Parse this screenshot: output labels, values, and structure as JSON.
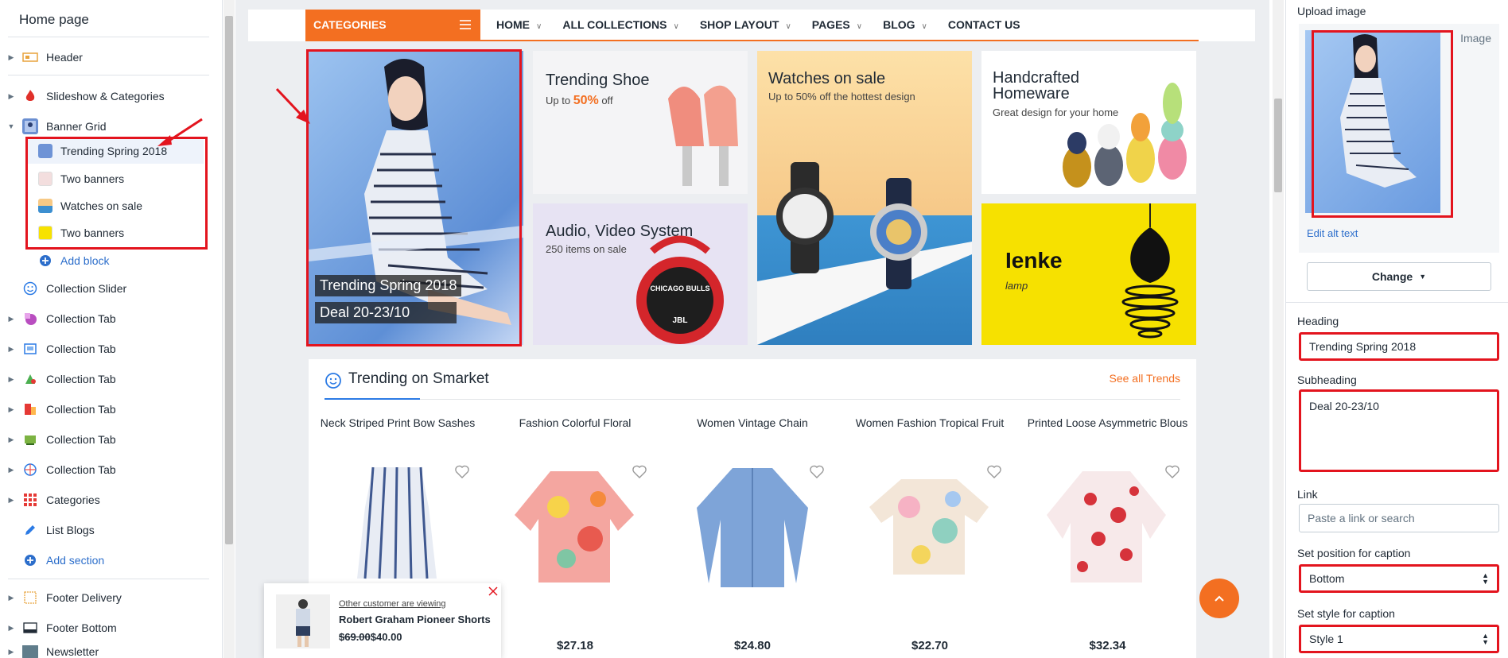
{
  "sidebar": {
    "title": "Home page",
    "sections": [
      {
        "label": "Header",
        "icon": "header-icon"
      },
      {
        "label": "Slideshow & Categories",
        "icon": "slideshow-icon"
      },
      {
        "label": "Banner Grid",
        "icon": "banner-grid-icon",
        "expanded": true
      }
    ],
    "blocks": [
      {
        "label": "Trending Spring 2018",
        "selected": true
      },
      {
        "label": "Two banners"
      },
      {
        "label": "Watches on sale"
      },
      {
        "label": "Two banners"
      }
    ],
    "add_block": "Add block",
    "more_sections": [
      {
        "label": "Collection Slider"
      },
      {
        "label": "Collection Tab"
      },
      {
        "label": "Collection Tab"
      },
      {
        "label": "Collection Tab"
      },
      {
        "label": "Collection Tab"
      },
      {
        "label": "Collection Tab"
      },
      {
        "label": "Collection Tab"
      },
      {
        "label": "Categories"
      },
      {
        "label": "List Blogs"
      }
    ],
    "add_section": "Add section",
    "footer_sections": [
      {
        "label": "Footer Delivery"
      },
      {
        "label": "Footer Bottom"
      },
      {
        "label": "Newsletter"
      }
    ]
  },
  "store": {
    "categories_label": "CATEGORIES",
    "nav": [
      "HOME",
      "ALL COLLECTIONS",
      "SHOP LAYOUT",
      "PAGES",
      "BLOG",
      "CONTACT US"
    ],
    "banners": {
      "main": {
        "heading": "Trending Spring 2018",
        "subheading": "Deal 20-23/10"
      },
      "shoe": {
        "heading": "Trending Shoe",
        "sub_pre": "Up to ",
        "sub_accent": "50%",
        "sub_post": " off"
      },
      "watches": {
        "heading": "Watches on sale",
        "sub": "Up to 50% off the hottest design"
      },
      "homeware": {
        "heading": "Handcrafted Homeware",
        "sub": "Great design for your home"
      },
      "audio": {
        "heading": "Audio, Video System",
        "sub": "250 items on sale",
        "speaker_text": "CHICAGO BULLS",
        "speaker_brand": "JBL"
      },
      "lamp": {
        "heading": "Ienke",
        "sub": "lamp"
      }
    },
    "trending": {
      "title": "Trending on Smarket",
      "see_all": "See all Trends"
    },
    "products": [
      {
        "name": "Neck Striped Print Bow Sashes",
        "price": ""
      },
      {
        "name": "Fashion Colorful Floral",
        "price": "$27.18"
      },
      {
        "name": "Women Vintage Chain",
        "price": "$24.80"
      },
      {
        "name": "Women Fashion Tropical Fruit",
        "price": "$22.70"
      },
      {
        "name": "Printed Loose Asymmetric Blous",
        "price": "$32.34"
      }
    ],
    "popup": {
      "note": "Other customer are viewing",
      "product": "Robert Graham Pioneer Shorts",
      "old_price": "$69.00",
      "new_price": "$40.00"
    }
  },
  "panel": {
    "upload_label": "Upload image",
    "image_tag": "Image",
    "edit_alt": "Edit alt text",
    "change_button": "Change",
    "heading_label": "Heading",
    "heading_value": "Trending Spring 2018",
    "subheading_label": "Subheading",
    "subheading_value": "Deal 20-23/10",
    "link_label": "Link",
    "link_placeholder": "Paste a link or search",
    "position_label": "Set position for caption",
    "position_value": "Bottom",
    "style_label": "Set style for caption",
    "style_value": "Style 1"
  },
  "colors": {
    "accent": "#f36f21",
    "highlight": "#e3141e",
    "link": "#2c6ecb"
  }
}
